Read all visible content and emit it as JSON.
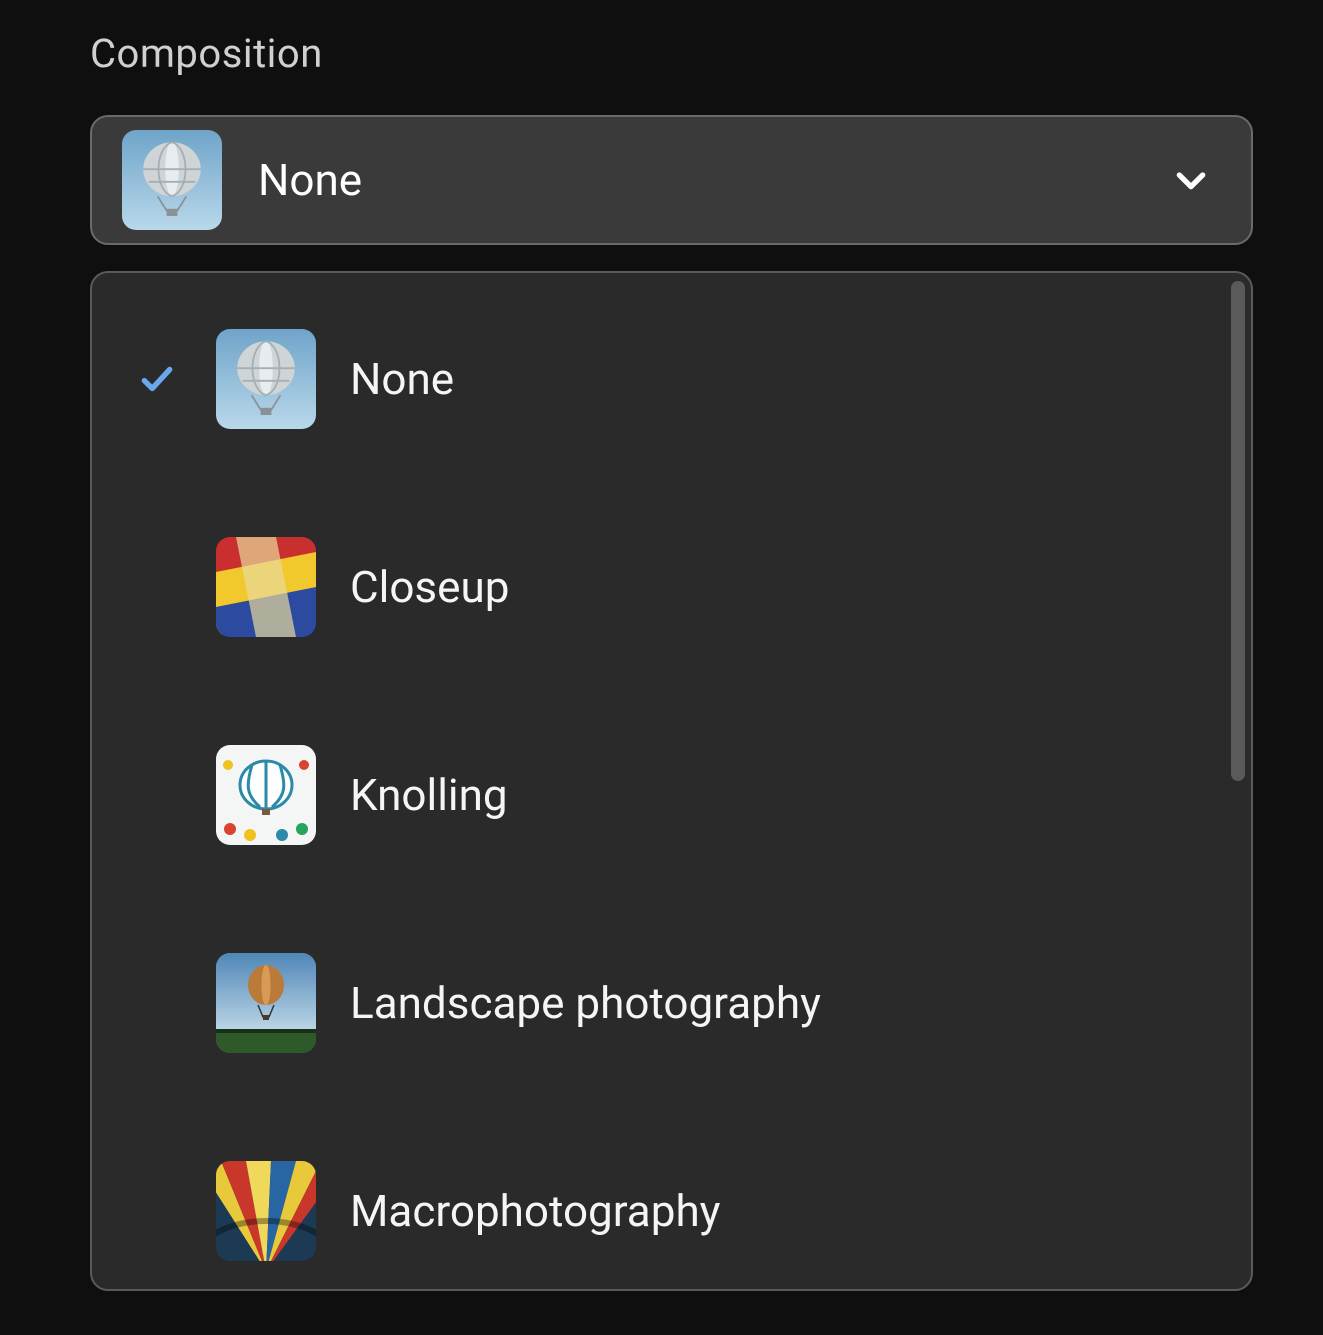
{
  "section_label": "Composition",
  "selected": {
    "label": "None",
    "thumb_kind": "none"
  },
  "options": [
    {
      "label": "None",
      "thumb_kind": "none",
      "selected": true
    },
    {
      "label": "Closeup",
      "thumb_kind": "closeup",
      "selected": false
    },
    {
      "label": "Knolling",
      "thumb_kind": "knolling",
      "selected": false
    },
    {
      "label": "Landscape photography",
      "thumb_kind": "landscape",
      "selected": false
    },
    {
      "label": "Macrophotography",
      "thumb_kind": "macro",
      "selected": false
    }
  ],
  "icons": {
    "chevron_down": "chevron-down-icon",
    "check": "check-icon"
  }
}
